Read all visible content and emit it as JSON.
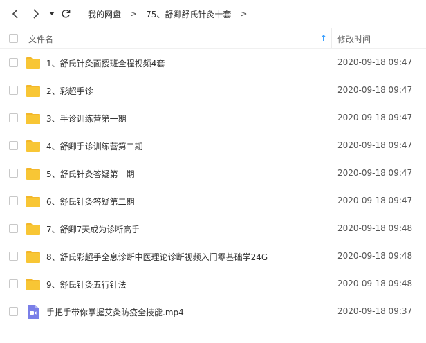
{
  "toolbar": {
    "back_icon": "chevron-left-icon",
    "forward_icon": "chevron-right-icon",
    "dropdown_icon": "caret-down-icon",
    "refresh_icon": "refresh-icon"
  },
  "breadcrumb": {
    "items": [
      "我的网盘",
      "75、舒卿舒氏针灸十套"
    ],
    "separator": ">"
  },
  "header": {
    "name_label": "文件名",
    "time_label": "修改时间",
    "sort_icon": "sort-arrow-up-icon",
    "sort_color": "#3aa0ff"
  },
  "colors": {
    "folder": "#f8c635",
    "folder_tab": "#f3b72b",
    "video": "#7a7fe8"
  },
  "files": [
    {
      "type": "folder",
      "name": "1、舒氏针灸面授班全程视频4套",
      "time": "2020-09-18 09:47"
    },
    {
      "type": "folder",
      "name": "2、彩超手诊",
      "time": "2020-09-18 09:47"
    },
    {
      "type": "folder",
      "name": "3、手诊训练营第一期",
      "time": "2020-09-18 09:47"
    },
    {
      "type": "folder",
      "name": "4、舒卿手诊训练营第二期",
      "time": "2020-09-18 09:47"
    },
    {
      "type": "folder",
      "name": "5、舒氏针灸答疑第一期",
      "time": "2020-09-18 09:47"
    },
    {
      "type": "folder",
      "name": "6、舒氏针灸答疑第二期",
      "time": "2020-09-18 09:47"
    },
    {
      "type": "folder",
      "name": "7、舒卿7天成为诊断高手",
      "time": "2020-09-18 09:48"
    },
    {
      "type": "folder",
      "name": "8、舒氏彩超手全息诊断中医理论诊断视频入门零基础学24G",
      "time": "2020-09-18 09:48"
    },
    {
      "type": "folder",
      "name": "9、舒氏针灸五行针法",
      "time": "2020-09-18 09:48"
    },
    {
      "type": "video",
      "name": "手把手带你掌握艾灸防疫全技能.mp4",
      "time": "2020-09-18 09:37"
    }
  ]
}
